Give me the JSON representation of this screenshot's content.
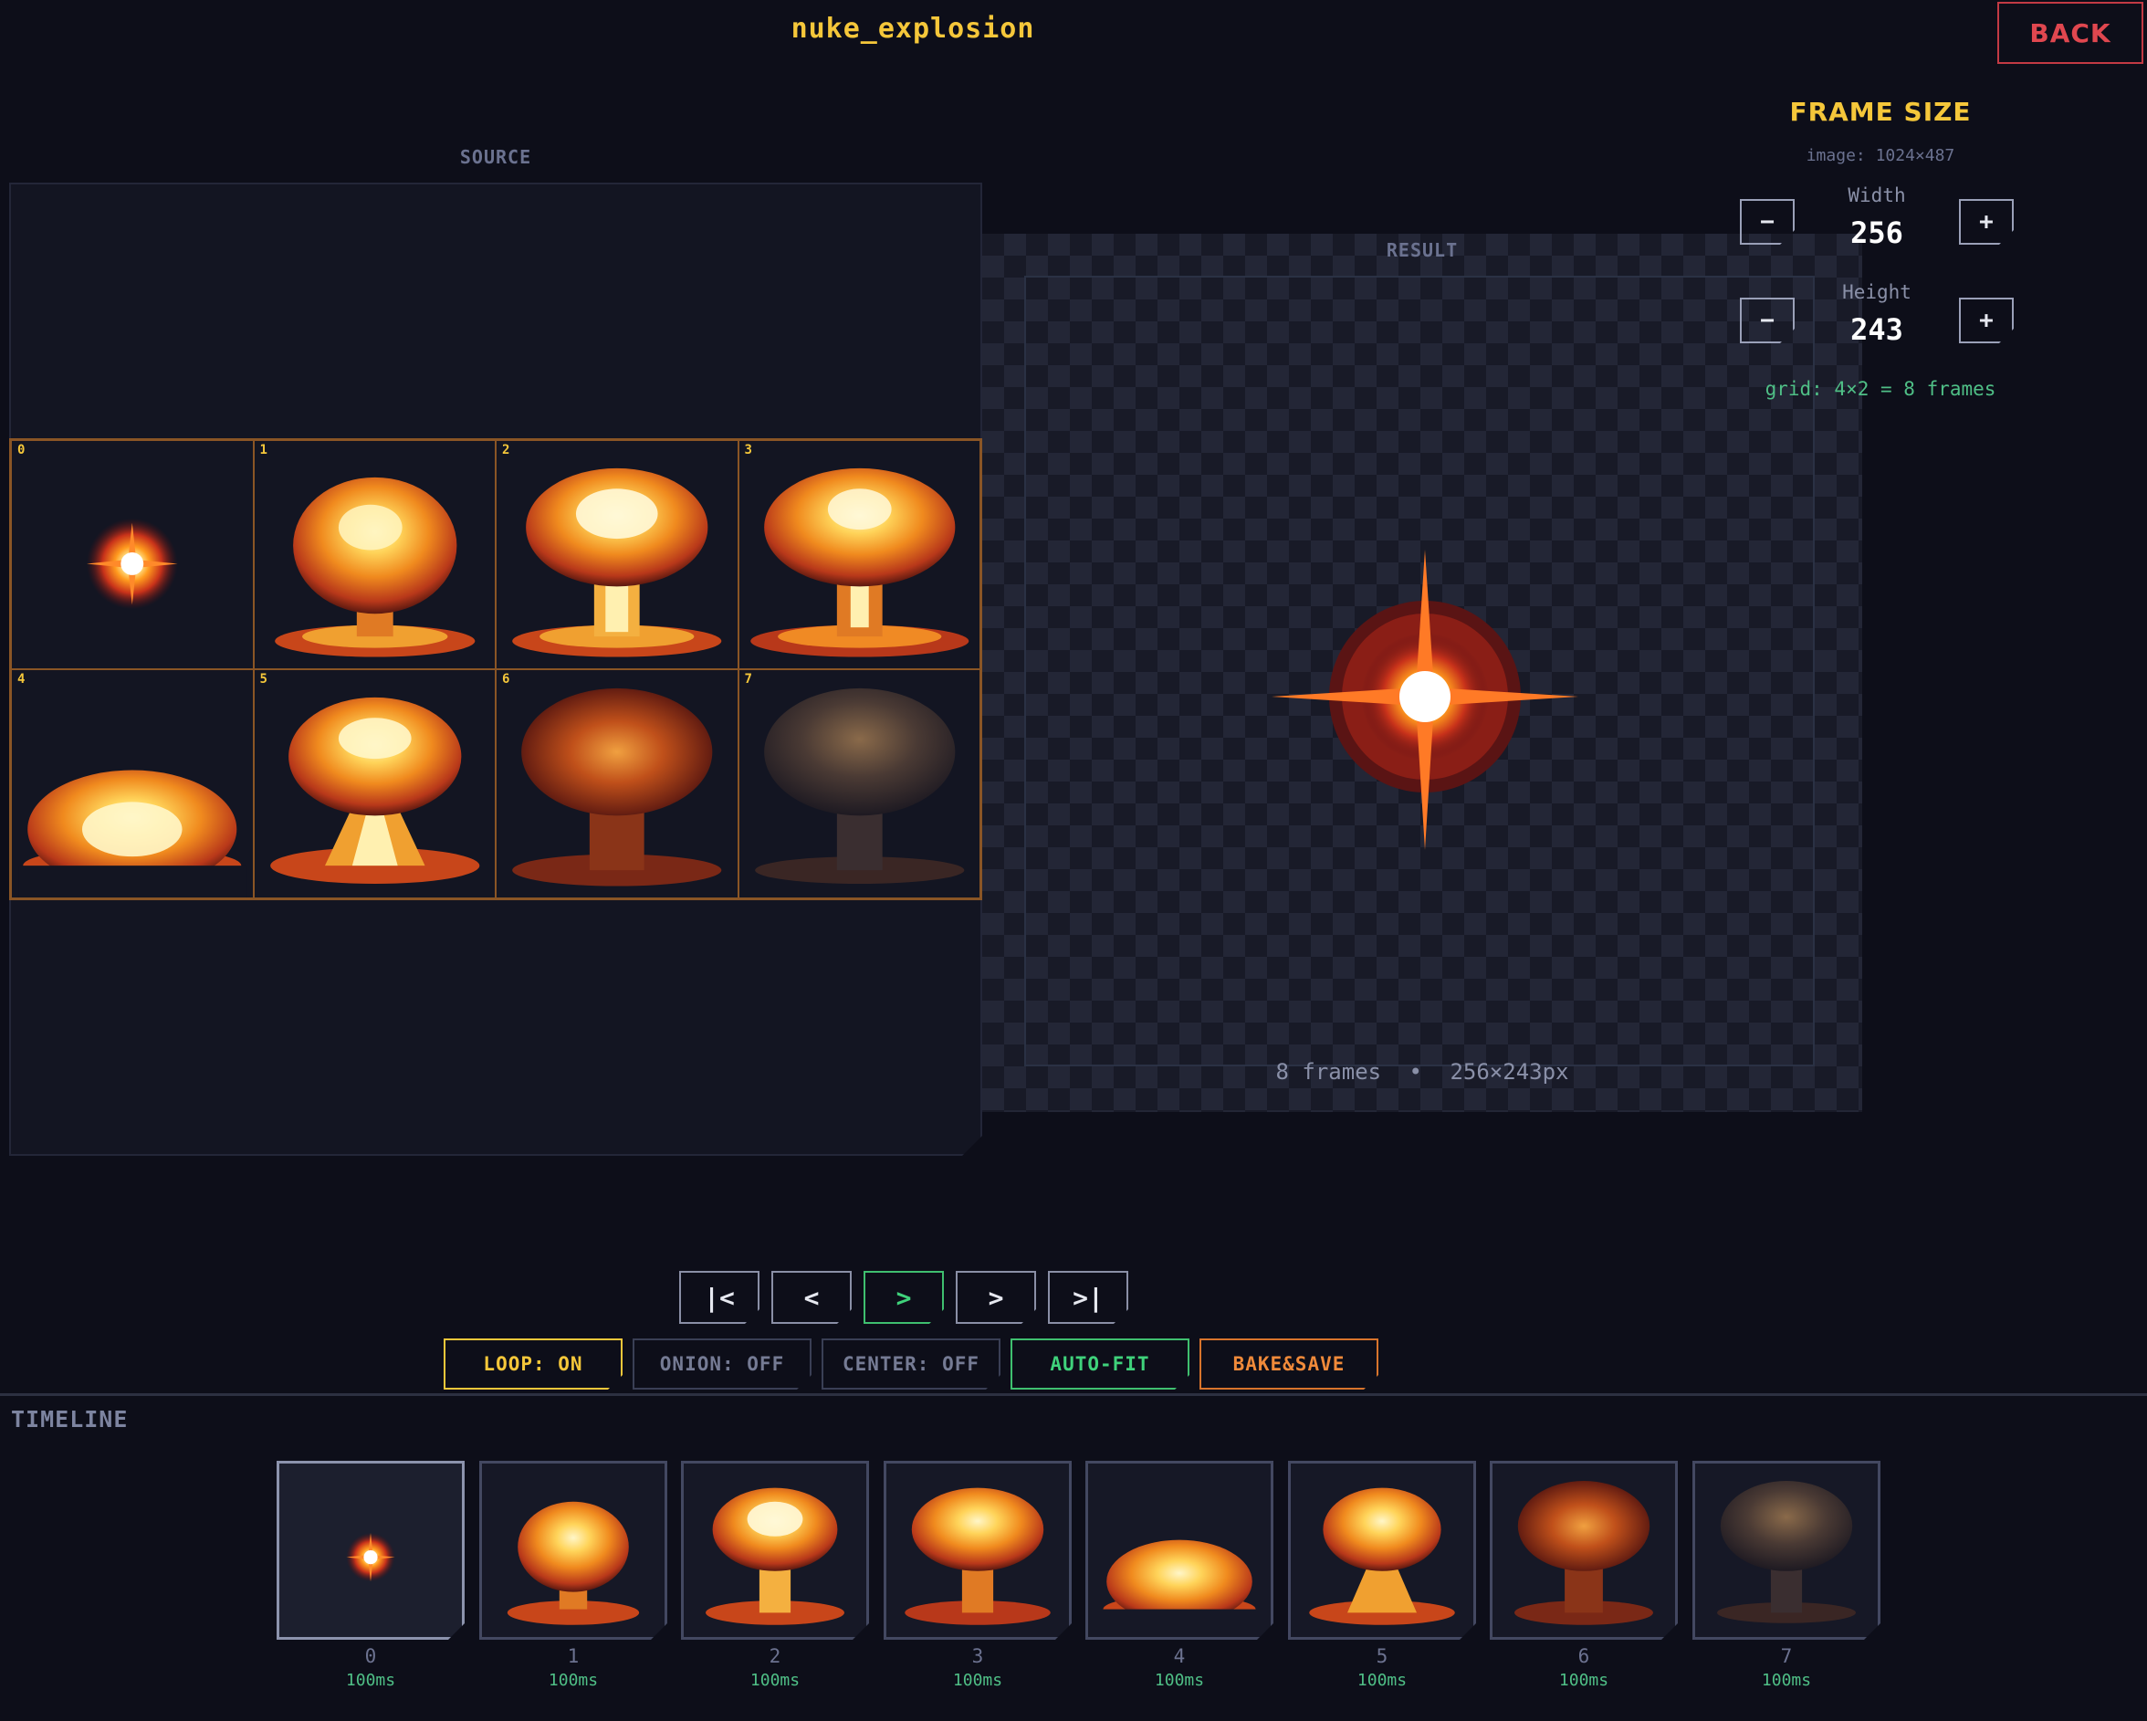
{
  "header": {
    "title": "nuke_explosion",
    "back_label": "BACK"
  },
  "source": {
    "label": "SOURCE",
    "frame_numbers": [
      "0",
      "1",
      "2",
      "3",
      "4",
      "5",
      "6",
      "7"
    ]
  },
  "result": {
    "label": "RESULT",
    "frames_text": "8 frames",
    "separator": "•",
    "size_text": "256×243px"
  },
  "frame_size": {
    "title": "FRAME SIZE",
    "image_info": "image: 1024×487",
    "width_label": "Width",
    "width_value": "256",
    "height_label": "Height",
    "height_value": "243",
    "minus": "−",
    "plus": "+",
    "grid_info": "grid: 4×2 = 8 frames"
  },
  "playback": {
    "first": "|<",
    "prev": "<",
    "play": ">",
    "next": ">",
    "last": ">|"
  },
  "options": {
    "loop": "LOOP: ON",
    "onion": "ONION: OFF",
    "center": "CENTER: OFF",
    "autofit": "AUTO-FIT",
    "bake": "BAKE&SAVE",
    "colors": {
      "loop": "#f5c73a",
      "autofit": "#3fd27b",
      "bake": "#f08a3a",
      "off": "#757b94"
    }
  },
  "timeline": {
    "label": "TIMELINE",
    "frames": [
      {
        "index": "0",
        "duration": "100ms"
      },
      {
        "index": "1",
        "duration": "100ms"
      },
      {
        "index": "2",
        "duration": "100ms"
      },
      {
        "index": "3",
        "duration": "100ms"
      },
      {
        "index": "4",
        "duration": "100ms"
      },
      {
        "index": "5",
        "duration": "100ms"
      },
      {
        "index": "6",
        "duration": "100ms"
      },
      {
        "index": "7",
        "duration": "100ms"
      }
    ]
  }
}
